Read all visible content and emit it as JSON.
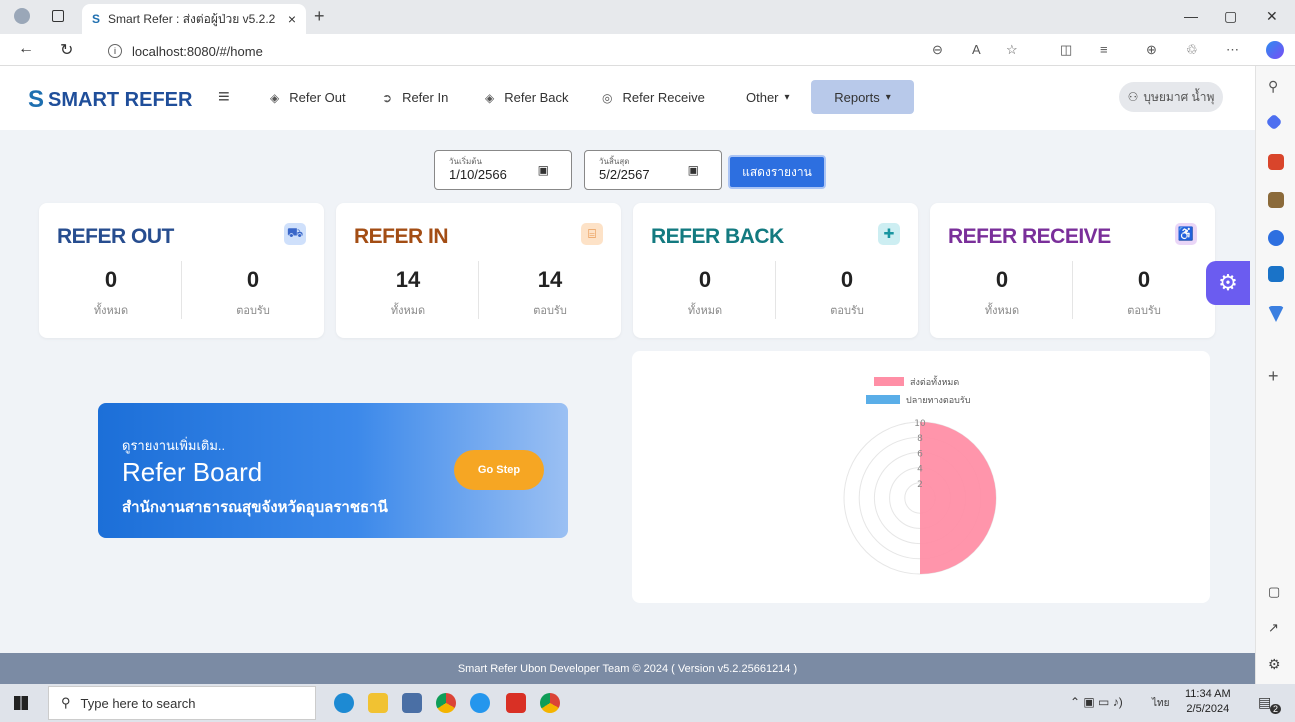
{
  "browser": {
    "tab_title": "Smart Refer : ส่งต่อผู้ป่วย v5.2.2",
    "url": "localhost:8080/#/home"
  },
  "header": {
    "logo": "SMART REFER",
    "nav": [
      "Refer Out",
      "Refer In",
      "Refer Back",
      "Refer Receive"
    ],
    "other": "Other",
    "reports": "Reports",
    "user": "บุษยมาศ น้ำพุ"
  },
  "filters": {
    "start_label": "วันเริ่มต้น",
    "start_value": "1/10/2566",
    "end_label": "วันสิ้นสุด",
    "end_value": "5/2/2567",
    "show_button": "แสดงรายงาน"
  },
  "cards": [
    {
      "title": "REFER OUT",
      "color": "#274d8f",
      "icon_bg": "#cfe0fb",
      "icon_color": "#3a67c9",
      "icon": "truck-icon",
      "total": "0",
      "accepted": "0"
    },
    {
      "title": "REFER IN",
      "color": "#a34d14",
      "icon_bg": "#fde2c7",
      "icon_color": "#e07a22",
      "icon": "bed-icon",
      "total": "14",
      "accepted": "14"
    },
    {
      "title": "REFER BACK",
      "color": "#137a80",
      "icon_bg": "#cdeef2",
      "icon_color": "#1895a0",
      "icon": "ambulance-icon",
      "total": "0",
      "accepted": "0"
    },
    {
      "title": "REFER RECEIVE",
      "color": "#7a2f9a",
      "icon_bg": "#ead6f7",
      "icon_color": "#9b40cc",
      "icon": "wheelchair-icon",
      "total": "0",
      "accepted": "0"
    }
  ],
  "card_labels": {
    "total": "ทั้งหมด",
    "accepted": "ตอบรับ"
  },
  "banner": {
    "small": "ดูรายงานเพิ่มเติม..",
    "big": "Refer Board",
    "org": "สำนักงานสาธารณสุขจังหวัดอุบลราชธานี",
    "button": "Go Step"
  },
  "chart_data": {
    "type": "pie",
    "series": [
      {
        "name": "ส่งต่อทั้งหมด",
        "color": "#ff8fa6",
        "value": 10
      },
      {
        "name": "ปลายทางตอบรับ",
        "color": "#5aaee8",
        "value": 0
      }
    ],
    "radial_ticks": [
      "10",
      "8",
      "6",
      "4",
      "2"
    ],
    "max": 10
  },
  "footer": "Smart Refer Ubon Developer Team © 2024 ( Version v5.2.25661214 )",
  "taskbar": {
    "search_placeholder": "Type here to search",
    "time": "11:34 AM",
    "date": "2/5/2024",
    "lang": "ไทย",
    "notif_count": "2"
  }
}
